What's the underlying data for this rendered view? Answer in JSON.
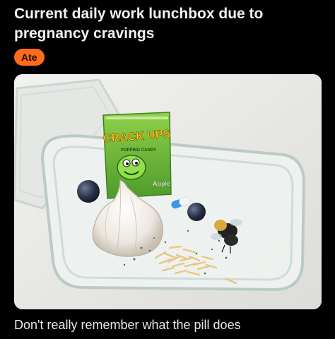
{
  "post": {
    "title": "Current daily work lunchbox due to pregnancy cravings",
    "flair": "Ate",
    "flair_color": "#ff6b1a",
    "caption": "Don't really remember what the pill does"
  },
  "image": {
    "packet_brand": "CRACK UPS",
    "packet_subtitle": "POPPING CANDY",
    "packet_flavor": "Apple"
  },
  "colors": {
    "background": "#000000",
    "text": "#e7e9ea"
  }
}
